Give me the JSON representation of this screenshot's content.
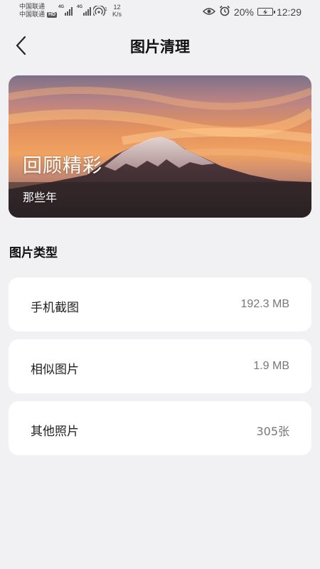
{
  "status_bar": {
    "carrier_1": "中国联通",
    "carrier_2": "中国联通",
    "hd_badge": "HD",
    "network_1": "4G",
    "network_2": "4G",
    "hotspot_count": "1",
    "speed_value": "12",
    "speed_unit": "K/s",
    "battery_percent": "20%",
    "time": "12:29",
    "icons": [
      "signal-icon",
      "hotspot-icon",
      "eye-icon",
      "alarm-icon",
      "battery-charging-icon"
    ]
  },
  "header": {
    "title": "图片清理",
    "back_icon": "chevron-left-icon"
  },
  "banner": {
    "title": "回顾精彩",
    "subtitle": "那些年"
  },
  "section": {
    "title": "图片类型"
  },
  "categories": [
    {
      "label": "手机截图",
      "value": "192.3 MB"
    },
    {
      "label": "相似图片",
      "value": "1.9 MB"
    },
    {
      "label": "其他照片",
      "value": "305张"
    }
  ],
  "colors": {
    "background": "#f1f1f3",
    "card": "#ffffff",
    "value_text": "#777777"
  }
}
